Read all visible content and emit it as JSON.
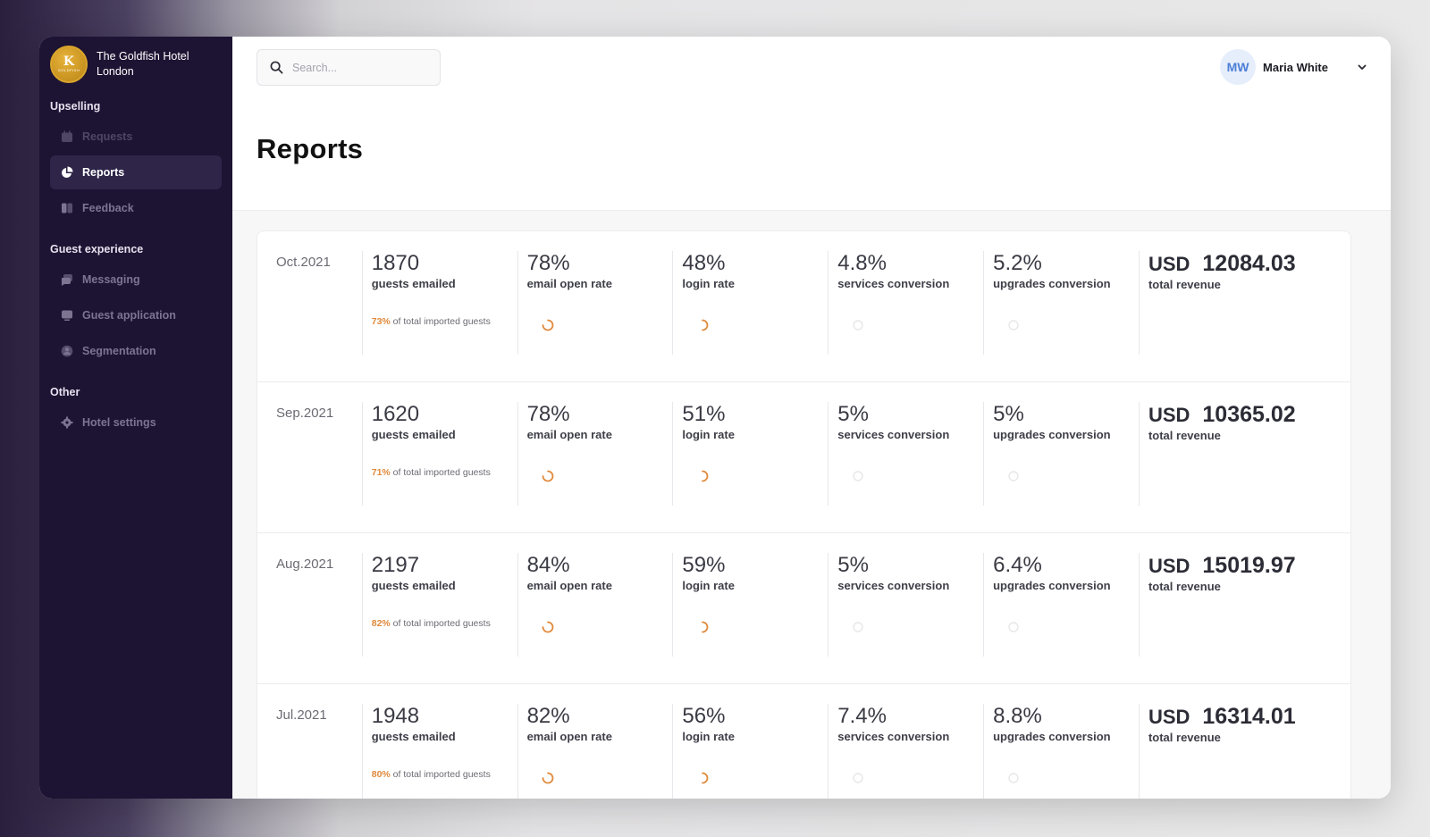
{
  "hotel": {
    "name": "The Goldfish Hotel London",
    "logo_initials": "K",
    "logo_text": "GOLDFISH"
  },
  "sidebar": {
    "sections": [
      {
        "title": "Upselling",
        "items": [
          {
            "label": "Requests",
            "icon": "calendar-icon",
            "state": "disabled"
          },
          {
            "label": "Reports",
            "icon": "pie-chart-icon",
            "state": "active"
          },
          {
            "label": "Feedback",
            "icon": "book-icon",
            "state": "normal"
          }
        ]
      },
      {
        "title": "Guest experience",
        "items": [
          {
            "label": "Messaging",
            "icon": "chat-icon",
            "state": "normal"
          },
          {
            "label": "Guest application",
            "icon": "monitor-icon",
            "state": "normal"
          },
          {
            "label": "Segmentation",
            "icon": "user-circle-icon",
            "state": "normal"
          }
        ]
      },
      {
        "title": "Other",
        "items": [
          {
            "label": "Hotel settings",
            "icon": "gear-icon",
            "state": "normal"
          }
        ]
      }
    ]
  },
  "search": {
    "placeholder": "Search..."
  },
  "user": {
    "initials": "MW",
    "name": "Maria White"
  },
  "page": {
    "title": "Reports"
  },
  "labels": {
    "guests_emailed": "guests emailed",
    "email_open_rate": "email open rate",
    "login_rate": "login rate",
    "services_conversion": "services conversion",
    "upgrades_conversion": "upgrades conversion",
    "total_revenue": "total revenue",
    "imported_note": "of total imported guests",
    "currency": "USD"
  },
  "colors": {
    "sidebar_bg": "#1d1333",
    "accent": "#e08a3c",
    "avatar_text": "#4d7fd6"
  },
  "reports": [
    {
      "period": "Oct.2021",
      "guests": "1870",
      "imported_pct": "73%",
      "open_rate": "78%",
      "login_rate": "48%",
      "services": "4.8%",
      "upgrades": "5.2%",
      "revenue": "12084.03"
    },
    {
      "period": "Sep.2021",
      "guests": "1620",
      "imported_pct": "71%",
      "open_rate": "78%",
      "login_rate": "51%",
      "services": "5%",
      "upgrades": "5%",
      "revenue": "10365.02"
    },
    {
      "period": "Aug.2021",
      "guests": "2197",
      "imported_pct": "82%",
      "open_rate": "84%",
      "login_rate": "59%",
      "services": "5%",
      "upgrades": "6.4%",
      "revenue": "15019.97"
    },
    {
      "period": "Jul.2021",
      "guests": "1948",
      "imported_pct": "80%",
      "open_rate": "82%",
      "login_rate": "56%",
      "services": "7.4%",
      "upgrades": "8.8%",
      "revenue": "16314.01"
    }
  ]
}
